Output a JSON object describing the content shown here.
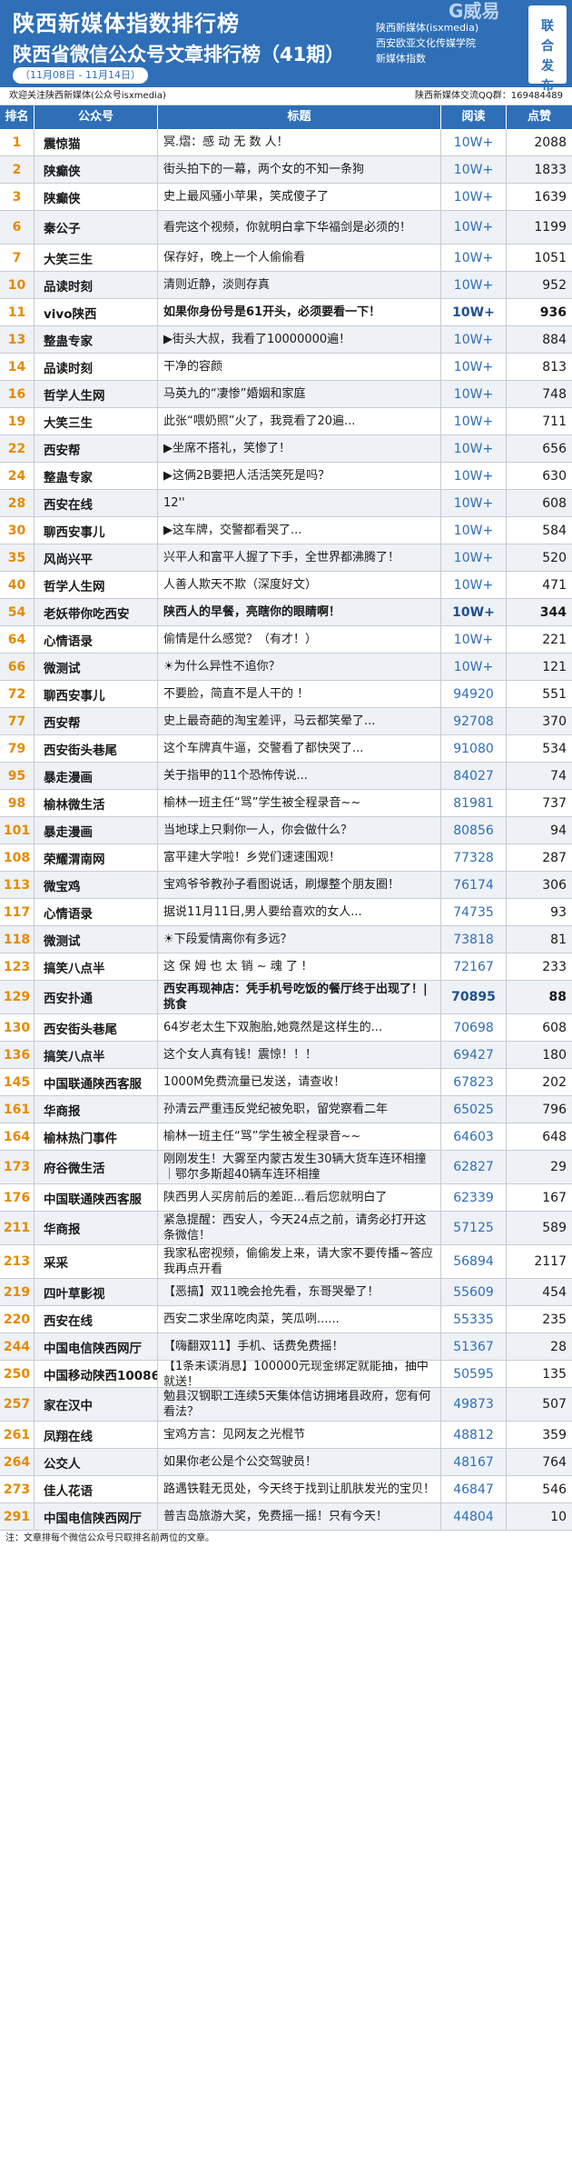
{
  "header": {
    "title": "陕西新媒体指数排行榜",
    "subtitle": "陕西省微信公众号文章排行榜（41期）",
    "date_range": "（11月08日 - 11月14日）",
    "publishers": [
      "陕西新媒体(isxmedia)",
      "西安欧亚文化传媒学院",
      "新媒体指数"
    ],
    "logo_text": "G威易",
    "badge": [
      "联",
      "合",
      "发",
      "布"
    ]
  },
  "infobar": {
    "left": "欢迎关注陕西新媒体(公众号isxmedia)",
    "right": "陕西新媒体交流QQ群：169484489"
  },
  "table": {
    "headers": [
      "排名",
      "公众号",
      "标题",
      "阅读",
      "点赞"
    ],
    "rows": [
      {
        "rank": "1",
        "account": "震惊猫",
        "title": "冥.熠：感 动 无 数 人！",
        "reads": "10W+",
        "likes": "2088",
        "bold": false
      },
      {
        "rank": "2",
        "account": "陕癫侠",
        "title": "街头拍下的一幕，两个女的不知一条狗",
        "reads": "10W+",
        "likes": "1833",
        "bold": false
      },
      {
        "rank": "3",
        "account": "陕癫侠",
        "title": "史上最风骚小苹果，笑成傻子了",
        "reads": "10W+",
        "likes": "1639",
        "bold": false
      },
      {
        "rank": "6",
        "account": "秦公子",
        "title": "看完这个视频，你就明白拿下华福剑是必须的！",
        "reads": "10W+",
        "likes": "1199",
        "bold": false
      },
      {
        "rank": "7",
        "account": "大笑三生",
        "title": "保存好，晚上一个人偷偷看",
        "reads": "10W+",
        "likes": "1051",
        "bold": false
      },
      {
        "rank": "10",
        "account": "品读时刻",
        "title": "清则近静，淡则存真",
        "reads": "10W+",
        "likes": "952",
        "bold": false
      },
      {
        "rank": "11",
        "account": "vivo陕西",
        "title": "如果你身份号是61开头，必须要看一下！",
        "reads": "10W+",
        "likes": "936",
        "bold": true
      },
      {
        "rank": "13",
        "account": "整蛊专家",
        "title": "▶街头大叔，我看了10000000遍！",
        "reads": "10W+",
        "likes": "884",
        "bold": false
      },
      {
        "rank": "14",
        "account": "品读时刻",
        "title": "干净的容颜",
        "reads": "10W+",
        "likes": "813",
        "bold": false
      },
      {
        "rank": "16",
        "account": "哲学人生网",
        "title": "马英九的“凄惨”婚姻和家庭",
        "reads": "10W+",
        "likes": "748",
        "bold": false
      },
      {
        "rank": "19",
        "account": "大笑三生",
        "title": "此张“喂奶照”火了，我竟看了20遍...",
        "reads": "10W+",
        "likes": "711",
        "bold": false
      },
      {
        "rank": "22",
        "account": "西安帮",
        "title": "▶坐席不搭礼，笑惨了！",
        "reads": "10W+",
        "likes": "656",
        "bold": false
      },
      {
        "rank": "24",
        "account": "整蛊专家",
        "title": "▶这俩2B要把人活活笑死是吗？",
        "reads": "10W+",
        "likes": "630",
        "bold": false
      },
      {
        "rank": "28",
        "account": "西安在线",
        "title": "12''",
        "reads": "10W+",
        "likes": "608",
        "bold": false
      },
      {
        "rank": "30",
        "account": "聊西安事儿",
        "title": "▶这车牌，交警都看哭了...",
        "reads": "10W+",
        "likes": "584",
        "bold": false
      },
      {
        "rank": "35",
        "account": "风尚兴平",
        "title": "兴平人和富平人握了下手，全世界都沸腾了！",
        "reads": "10W+",
        "likes": "520",
        "bold": false
      },
      {
        "rank": "40",
        "account": "哲学人生网",
        "title": "人善人欺天不欺（深度好文）",
        "reads": "10W+",
        "likes": "471",
        "bold": false
      },
      {
        "rank": "54",
        "account": "老妖带你吃西安",
        "title": "陕西人的早餐，亮瞎你的眼睛啊！",
        "reads": "10W+",
        "likes": "344",
        "bold": true
      },
      {
        "rank": "64",
        "account": "心情语录",
        "title": "偷情是什么感觉？（有才！）",
        "reads": "10W+",
        "likes": "221",
        "bold": false
      },
      {
        "rank": "66",
        "account": "微测试",
        "title": "☀为什么异性不追你？",
        "reads": "10W+",
        "likes": "121",
        "bold": false
      },
      {
        "rank": "72",
        "account": "聊西安事儿",
        "title": "不要脸，简直不是人干的 ！",
        "reads": "94920",
        "likes": "551",
        "bold": false
      },
      {
        "rank": "77",
        "account": "西安帮",
        "title": "史上最奇葩的淘宝差评，马云都笑晕了...",
        "reads": "92708",
        "likes": "370",
        "bold": false
      },
      {
        "rank": "79",
        "account": "西安街头巷尾",
        "title": "这个车牌真牛逼，交警看了都快哭了...",
        "reads": "91080",
        "likes": "534",
        "bold": false
      },
      {
        "rank": "95",
        "account": "暴走漫画",
        "title": "关于指甲的11个恐怖传说...",
        "reads": "84027",
        "likes": "74",
        "bold": false
      },
      {
        "rank": "98",
        "account": "榆林微生活",
        "title": "榆林一班主任“骂”学生被全程录音~~",
        "reads": "81981",
        "likes": "737",
        "bold": false
      },
      {
        "rank": "101",
        "account": "暴走漫画",
        "title": "当地球上只剩你一人，你会做什么？",
        "reads": "80856",
        "likes": "94",
        "bold": false
      },
      {
        "rank": "108",
        "account": "荣耀渭南网",
        "title": "富平建大学啦！乡党们速速围观！",
        "reads": "77328",
        "likes": "287",
        "bold": false
      },
      {
        "rank": "113",
        "account": "微宝鸡",
        "title": "宝鸡爷爷教孙子看图说话，刷爆整个朋友圈！",
        "reads": "76174",
        "likes": "306",
        "bold": false
      },
      {
        "rank": "117",
        "account": "心情语录",
        "title": "据说11月11日,男人要给喜欢的女人...",
        "reads": "74735",
        "likes": "93",
        "bold": false
      },
      {
        "rank": "118",
        "account": "微测试",
        "title": "☀下段爱情离你有多远？",
        "reads": "73818",
        "likes": "81",
        "bold": false
      },
      {
        "rank": "123",
        "account": "搞笑八点半",
        "title": "这 保 姆 也 太 销 ~ 魂 了 !",
        "reads": "72167",
        "likes": "233",
        "bold": false
      },
      {
        "rank": "129",
        "account": "西安扑通",
        "title": "西安再现神店：凭手机号吃饭的餐厅终于出现了！| 挑食",
        "reads": "70895",
        "likes": "88",
        "bold": true
      },
      {
        "rank": "130",
        "account": "西安街头巷尾",
        "title": "64岁老太生下双胞胎,她竟然是这样生的...",
        "reads": "70698",
        "likes": "608",
        "bold": false
      },
      {
        "rank": "136",
        "account": "搞笑八点半",
        "title": "这个女人真有钱！震惊！！！",
        "reads": "69427",
        "likes": "180",
        "bold": false
      },
      {
        "rank": "145",
        "account": "中国联通陕西客服",
        "title": "1000M免费流量已发送，请查收！",
        "reads": "67823",
        "likes": "202",
        "bold": false
      },
      {
        "rank": "161",
        "account": "华商报",
        "title": "孙清云严重违反党纪被免职，留党察看二年",
        "reads": "65025",
        "likes": "796",
        "bold": false
      },
      {
        "rank": "164",
        "account": "榆林热门事件",
        "title": "榆林一班主任“骂”学生被全程录音~~",
        "reads": "64603",
        "likes": "648",
        "bold": false
      },
      {
        "rank": "173",
        "account": "府谷微生活",
        "title": "刚刚发生！大雾至内蒙古发生30辆大货车连环相撞｜鄂尔多斯超40辆车连环相撞",
        "reads": "62827",
        "likes": "29",
        "bold": false
      },
      {
        "rank": "176",
        "account": "中国联通陕西客服",
        "title": "陕西男人买房前后的差距...看后您就明白了",
        "reads": "62339",
        "likes": "167",
        "bold": false
      },
      {
        "rank": "211",
        "account": "华商报",
        "title": "紧急提醒：西安人，今天24点之前，请务必打开这条微信！",
        "reads": "57125",
        "likes": "589",
        "bold": false
      },
      {
        "rank": "213",
        "account": "采采",
        "title": "我家私密视频，偷偷发上来，请大家不要传播~答应我再点开看",
        "reads": "56894",
        "likes": "2117",
        "bold": false
      },
      {
        "rank": "219",
        "account": "四叶草影视",
        "title": "【恶搞】双11晚会抢先看，东哥哭晕了！",
        "reads": "55609",
        "likes": "454",
        "bold": false
      },
      {
        "rank": "220",
        "account": "西安在线",
        "title": "西安二求坐席吃肉菜，笑瓜咧......",
        "reads": "55335",
        "likes": "235",
        "bold": false
      },
      {
        "rank": "244",
        "account": "中国电信陕西网厅",
        "title": "【嗨翻双11】手机、话费免费摇！",
        "reads": "51367",
        "likes": "28",
        "bold": false
      },
      {
        "rank": "250",
        "account": "中国移动陕西10086",
        "title": "【1条未读消息】100000元现金绑定就能抽，抽中就送！",
        "reads": "50595",
        "likes": "135",
        "bold": false
      },
      {
        "rank": "257",
        "account": "家在汉中",
        "title": "勉县汉钢职工连续5天集体信访拥堵县政府，您有何看法？",
        "reads": "49873",
        "likes": "507",
        "bold": false
      },
      {
        "rank": "261",
        "account": "凤翔在线",
        "title": "宝鸡方言：见网友之光棍节",
        "reads": "48812",
        "likes": "359",
        "bold": false
      },
      {
        "rank": "264",
        "account": "公交人",
        "title": "如果你老公是个公交驾驶员！",
        "reads": "48167",
        "likes": "764",
        "bold": false
      },
      {
        "rank": "273",
        "account": "佳人花语",
        "title": "路遇铁鞋无觅处，今天终于找到让肌肤发光的宝贝！",
        "reads": "46847",
        "likes": "546",
        "bold": false
      },
      {
        "rank": "291",
        "account": "中国电信陕西网厅",
        "title": "普吉岛旅游大奖，免费摇一摇！只有今天！",
        "reads": "44804",
        "likes": "10",
        "bold": false
      }
    ]
  },
  "footnote": "注：文章排每个微信公众号只取排名前两位的文章。"
}
